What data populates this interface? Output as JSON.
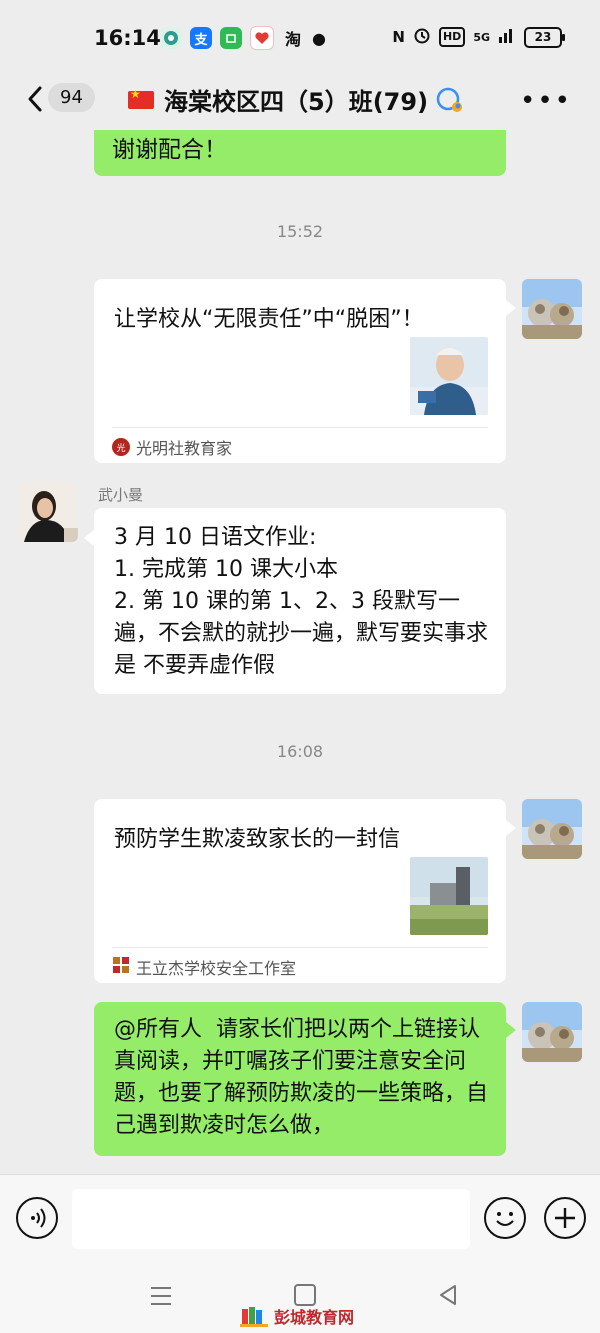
{
  "status_bar": {
    "time": "16:14",
    "app_icons": [
      "camera-app-icon",
      "alipay-icon",
      "wechat-mini-icon",
      "health-app-icon",
      "taobao-icon"
    ],
    "taobao_glyph": "淘",
    "alipay_glyph": "支",
    "right_labels": {
      "nfc": "N",
      "hd": "HD",
      "network": "5G",
      "battery": "23"
    }
  },
  "nav": {
    "unread_count": "94",
    "title": "海棠校区四（5）班(79)"
  },
  "messages": {
    "m1_text": "谢谢配合！",
    "time1": "15:52",
    "card1": {
      "title": "让学校从“无限责任”中“脱困”！",
      "source": "光明社教育家",
      "source_logo": "光明社"
    },
    "m3": {
      "sender": "武小曼",
      "text": "3 月 10 日语文作业:\n1. 完成第 10 课大小本\n2. 第 10 课的第 1、2、3 段默写一遍，不会默的就抄一遍，默写要实事求是 不要弄虚作假"
    },
    "time2": "16:08",
    "card2": {
      "title": "预防学生欺凌致家长的一封信",
      "source": "王立杰学校安全工作室"
    },
    "m5_text": "@所有人  请家长们把以两个上链接认真阅读，并叮嘱孩子们要注意安全问题，也要了解预防欺凌的一些策略，自己遇到欺凌时怎么做，"
  },
  "input": {
    "placeholder": ""
  },
  "watermark": {
    "text": "彭城教育网"
  },
  "colors": {
    "bubble_green": "#95ec69",
    "background": "#ededed",
    "watermark_red": "#c0282d"
  }
}
